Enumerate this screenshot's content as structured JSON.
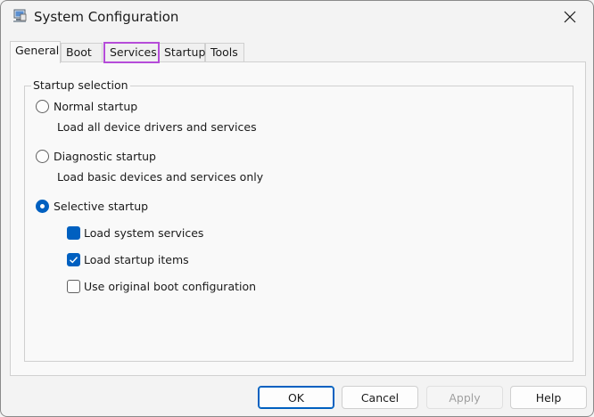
{
  "window": {
    "title": "System Configuration",
    "close_glyph": "✕"
  },
  "tabs": [
    {
      "label": "General",
      "active": true
    },
    {
      "label": "Boot",
      "active": false
    },
    {
      "label": "Services",
      "active": false,
      "highlighted": true
    },
    {
      "label": "Startup",
      "active": false
    },
    {
      "label": "Tools",
      "active": false
    }
  ],
  "startup_selection": {
    "legend": "Startup selection",
    "options": [
      {
        "label": "Normal startup",
        "description": "Load all device drivers and services",
        "selected": false
      },
      {
        "label": "Diagnostic startup",
        "description": "Load basic devices and services only",
        "selected": false
      },
      {
        "label": "Selective startup",
        "selected": true
      }
    ],
    "selective_items": [
      {
        "label": "Load system services",
        "state": "indeterminate"
      },
      {
        "label": "Load startup items",
        "state": "checked"
      },
      {
        "label": "Use original boot configuration",
        "state": "unchecked"
      }
    ]
  },
  "buttons": {
    "ok": "OK",
    "cancel": "Cancel",
    "apply": "Apply",
    "help": "Help"
  },
  "colors": {
    "accent": "#0060c0",
    "highlight_outline": "#b54cd9"
  },
  "icons": {
    "app": "msconfig-icon",
    "close": "close-icon"
  }
}
